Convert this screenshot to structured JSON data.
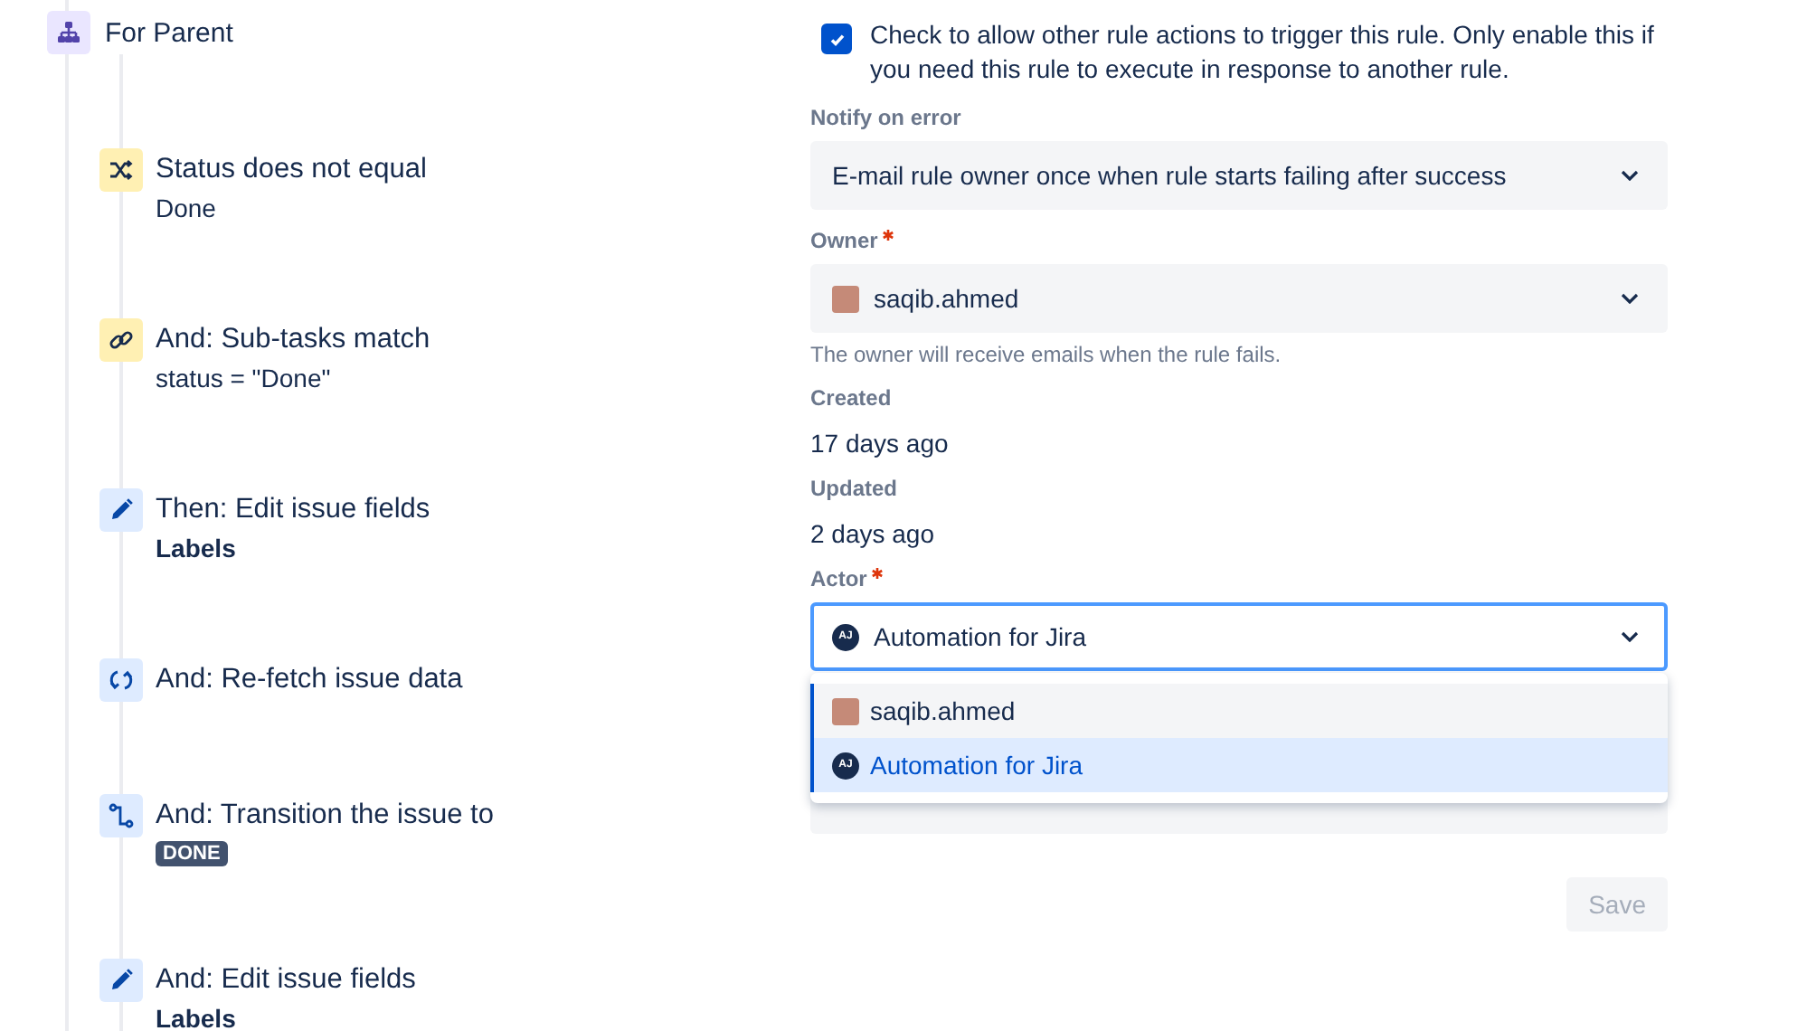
{
  "branch": {
    "title": "For Parent"
  },
  "steps": [
    {
      "kind": "status-condition",
      "title": "Status does not equal",
      "detail": {
        "kind": "plain",
        "text": "Done"
      }
    },
    {
      "kind": "subtask-condition",
      "title": "And: Sub-tasks match",
      "detail": {
        "kind": "plain",
        "text": "status = \"Done\""
      }
    },
    {
      "kind": "edit",
      "title": "Then: Edit issue fields",
      "detail": {
        "kind": "bold",
        "text": "Labels"
      }
    },
    {
      "kind": "refetch",
      "title": "And: Re-fetch issue data"
    },
    {
      "kind": "transition",
      "title": "And: Transition the issue to",
      "detail": {
        "kind": "lozenge",
        "text": "DONE"
      }
    },
    {
      "kind": "edit",
      "title": "And: Edit issue fields",
      "detail": {
        "kind": "bold",
        "text": "Labels"
      }
    }
  ],
  "rule_trigger": {
    "checked": true,
    "text": "Check to allow other rule actions to trigger this rule. Only enable this if you need this rule to execute in response to another rule."
  },
  "notify": {
    "label": "Notify on error",
    "value": "E-mail rule owner once when rule starts failing after success"
  },
  "owner": {
    "label": "Owner",
    "required": true,
    "value": "saqib.ahmed",
    "helper": "The owner will receive emails when the rule fails."
  },
  "created": {
    "label": "Created",
    "value": "17 days ago"
  },
  "updated": {
    "label": "Updated",
    "value": "2 days ago"
  },
  "actor": {
    "label": "Actor",
    "required": true,
    "value": "Automation for Jira",
    "initials": "AJ",
    "focused": true
  },
  "actor_menu": [
    {
      "kind": "photo",
      "label": "saqib.ahmed",
      "selected": false
    },
    {
      "kind": "initials",
      "initials": "AJ",
      "label": "Automation for Jira",
      "selected": true
    }
  ],
  "save": {
    "label": "Save",
    "disabled": true
  }
}
